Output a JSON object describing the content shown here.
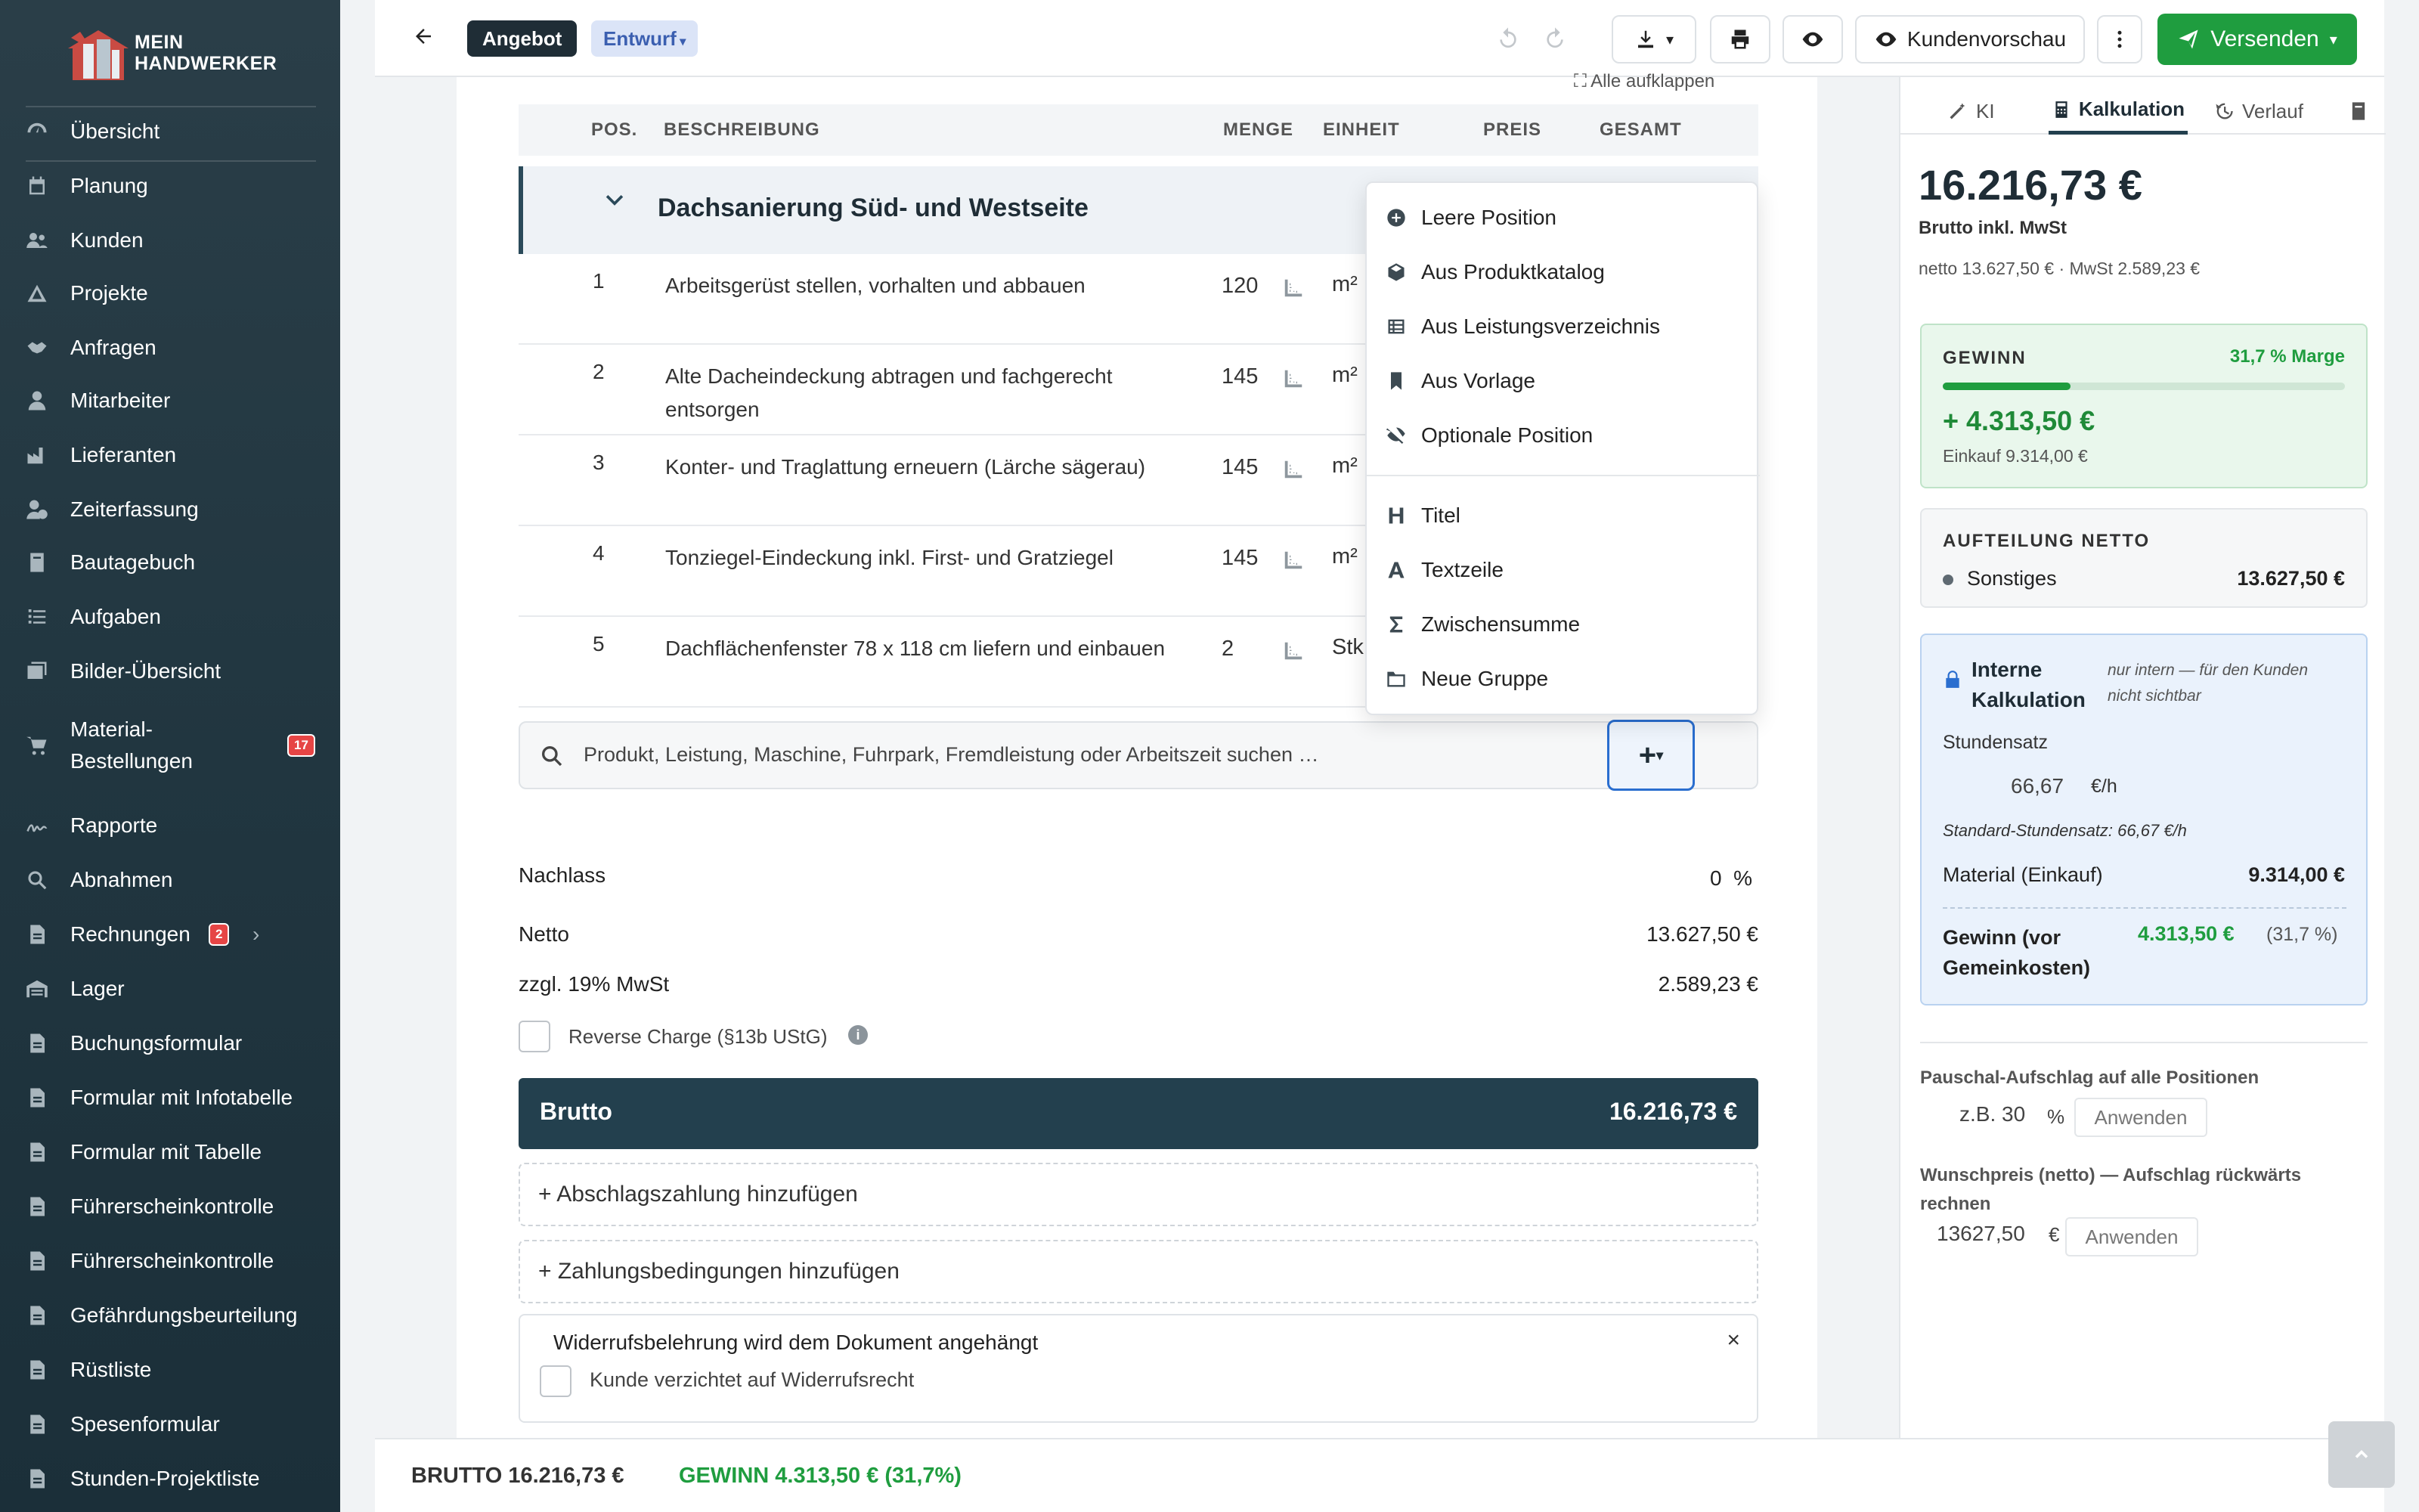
{
  "app": {
    "logo_line1": "MEIN",
    "logo_line2": "HANDWERKER"
  },
  "sidebar": {
    "items": [
      {
        "label": "Übersicht",
        "icon": "dashboard-icon"
      },
      {
        "label": "Planung",
        "icon": "calendar-icon"
      },
      {
        "label": "Kunden",
        "icon": "users-icon"
      },
      {
        "label": "Projekte",
        "icon": "project-icon"
      },
      {
        "label": "Anfragen",
        "icon": "handshake-icon"
      },
      {
        "label": "Mitarbeiter",
        "icon": "user-icon"
      },
      {
        "label": "Lieferanten",
        "icon": "factory-icon"
      },
      {
        "label": "Zeiterfassung",
        "icon": "user-clock-icon"
      },
      {
        "label": "Bautagebuch",
        "icon": "book-icon"
      },
      {
        "label": "Aufgaben",
        "icon": "tasks-icon"
      },
      {
        "label": "Bilder-Übersicht",
        "icon": "images-icon"
      },
      {
        "label": "Material-Bestellungen",
        "label_line1": "Material-",
        "label_line2": "Bestellungen",
        "icon": "cart-icon",
        "badge": "17"
      },
      {
        "label": "Rapporte",
        "icon": "signature-icon"
      },
      {
        "label": "Abnahmen",
        "icon": "search-icon"
      },
      {
        "label": "Rechnungen",
        "icon": "document-icon",
        "badge": "2",
        "chevron": "›"
      },
      {
        "label": "Lager",
        "icon": "warehouse-icon"
      },
      {
        "label": "Buchungsformular",
        "icon": "document-icon"
      },
      {
        "label": "Formular mit Infotabelle",
        "icon": "document-icon"
      },
      {
        "label": "Formular mit Tabelle",
        "icon": "document-icon"
      },
      {
        "label": "Führerscheinkontrolle",
        "icon": "document-icon"
      },
      {
        "label": "Führerscheinkontrolle",
        "icon": "document-icon"
      },
      {
        "label": "Gefährdungsbeurteilung",
        "icon": "document-icon"
      },
      {
        "label": "Rüstliste",
        "icon": "document-icon"
      },
      {
        "label": "Spesenformular",
        "icon": "document-icon"
      },
      {
        "label": "Stunden-Projektliste",
        "icon": "document-icon"
      }
    ]
  },
  "topbar": {
    "doc_type": "Angebot",
    "status": "Entwurf",
    "preview_label": "Kundenvorschau",
    "send_label": "Versenden"
  },
  "table": {
    "expand_all": "Alle aufklappen",
    "headers": {
      "pos": "POS.",
      "desc": "BESCHREIBUNG",
      "qty": "MENGE",
      "unit": "EINHEIT",
      "price": "PREIS",
      "total": "GESAMT"
    },
    "group_title": "Dachsanierung Süd- und Westseite",
    "rows": [
      {
        "pos": "1",
        "desc": "Arbeitsgerüst stellen, vorhalten und abbauen",
        "qty": "120",
        "unit": "m²"
      },
      {
        "pos": "2",
        "desc": "Alte Dacheindeckung abtragen und fachgerecht entsorgen",
        "qty": "145",
        "unit": "m²"
      },
      {
        "pos": "3",
        "desc": "Konter- und Traglattung erneuern (Lärche sägerau)",
        "qty": "145",
        "unit": "m²"
      },
      {
        "pos": "4",
        "desc": "Tonziegel-Eindeckung inkl. First- und Gratziegel",
        "qty": "145",
        "unit": "m²"
      },
      {
        "pos": "5",
        "desc": "Dachflächenfenster 78 x 118 cm liefern und einbauen",
        "qty": "2",
        "unit": "Stk"
      }
    ],
    "search_placeholder": "Produkt, Leistung, Maschine, Fuhrpark, Fremdleistung oder Arbeitszeit suchen …"
  },
  "dropdown": {
    "items_top": [
      {
        "label": "Leere Position",
        "icon": "plus-circle-icon"
      },
      {
        "label": "Aus Produktkatalog",
        "icon": "box-icon"
      },
      {
        "label": "Aus Leistungsverzeichnis",
        "icon": "list-table-icon"
      },
      {
        "label": "Aus Vorlage",
        "icon": "bookmark-icon"
      },
      {
        "label": "Optionale Position",
        "icon": "eye-slash-icon"
      }
    ],
    "items_bottom": [
      {
        "label": "Titel",
        "icon": "heading-icon"
      },
      {
        "label": "Textzeile",
        "icon": "font-icon"
      },
      {
        "label": "Zwischensumme",
        "icon": "sigma-icon"
      },
      {
        "label": "Neue Gruppe",
        "icon": "folder-icon"
      }
    ]
  },
  "totals": {
    "discount_label": "Nachlass",
    "discount_value": "0",
    "discount_unit": "%",
    "net_label": "Netto",
    "net_value": "13.627,50 €",
    "vat_label": "zzgl. 19% MwSt",
    "vat_value": "2.589,23 €",
    "reverse_charge_label": "Reverse Charge (§13b UStG)",
    "gross_label": "Brutto",
    "gross_value": "16.216,73 €",
    "add_installment": "+ Abschlagszahlung hinzufügen",
    "add_terms": "+ Zahlungsbedingungen hinzufügen",
    "widerruf_title": "Widerrufsbelehrung wird dem Dokument angehängt",
    "widerruf_waive": "Kunde verzichtet auf Widerrufsrecht"
  },
  "panel": {
    "tabs": [
      {
        "label": "KI"
      },
      {
        "label": "Kalkulation"
      },
      {
        "label": "Verlauf"
      }
    ],
    "total": "16.216,73 €",
    "total_sub": "Brutto inkl. MwSt",
    "total_detail": "netto 13.627,50 € · MwSt 2.589,23 €",
    "profit_title": "GEWINN",
    "profit_margin": "31,7 % Marge",
    "profit_fraction": 0.317,
    "profit_value": "+ 4.313,50 €",
    "profit_purchase": "Einkauf 9.314,00 €",
    "split_title": "AUFTEILUNG NETTO",
    "split_label": "Sonstiges",
    "split_value": "13.627,50 €",
    "internal_title": "Interne Kalkulation",
    "internal_note": "nur intern — für den Kunden nicht sichtbar",
    "hourly_label": "Stundensatz",
    "hourly_value": "66,67",
    "hourly_unit": "€/h",
    "hourly_default": "Standard-Stundensatz: 66,67 €/h",
    "material_label": "Material (Einkauf)",
    "material_value": "9.314,00 €",
    "profit_pre_label": "Gewinn (vor Gemeinkosten)",
    "profit_pre_value": "4.313,50 €",
    "profit_pre_pct": "(31,7 %)",
    "markup_label": "Pauschal-Aufschlag auf alle Positionen",
    "markup_placeholder": "z.B. 30",
    "markup_unit": "%",
    "apply_label": "Anwenden",
    "wish_label": "Wunschpreis (netto) — Aufschlag rückwärts rechnen",
    "wish_value": "13627,50",
    "wish_unit": "€"
  },
  "footer": {
    "brutto": "BRUTTO 16.216,73 €",
    "gewinn": "GEWINN 4.313,50 € (31,7%)"
  },
  "colors": {
    "sidebar": "#23404e",
    "accent_green": "#1f9d3f",
    "brutto_bar": "#23404e",
    "badge_red": "#e64545"
  }
}
